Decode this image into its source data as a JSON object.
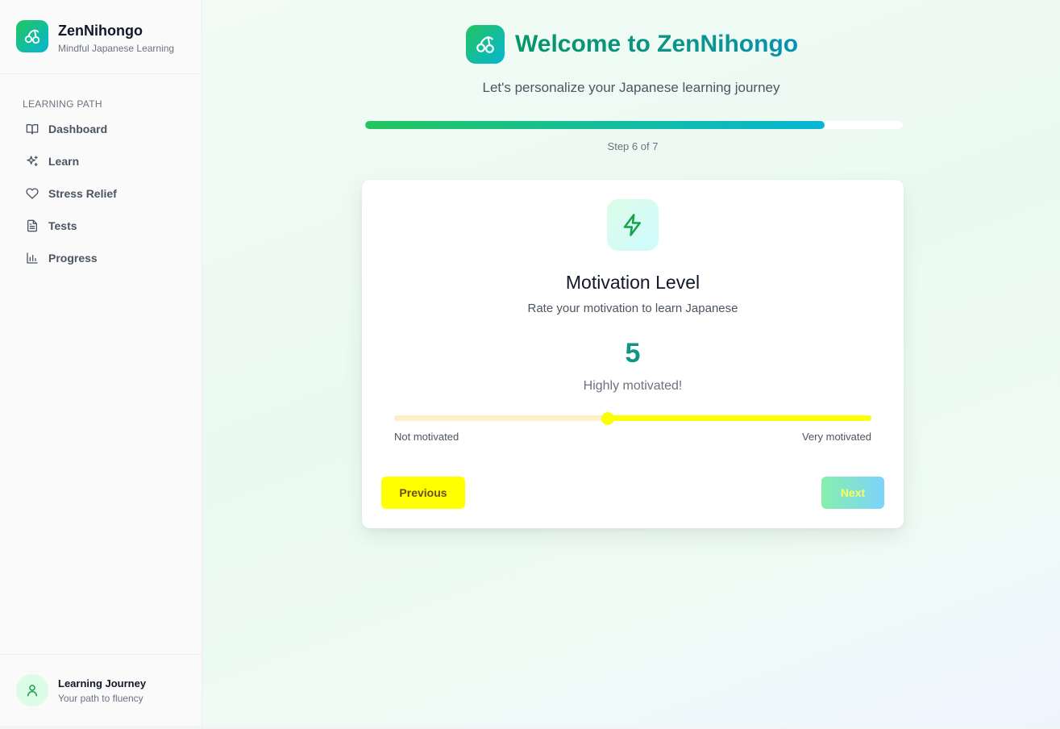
{
  "brand": {
    "title": "ZenNihongo",
    "subtitle": "Mindful Japanese Learning"
  },
  "sidebar": {
    "section_label": "LEARNING PATH",
    "items": [
      {
        "label": "Dashboard",
        "icon": "book-open-icon"
      },
      {
        "label": "Learn",
        "icon": "sparkles-icon"
      },
      {
        "label": "Stress Relief",
        "icon": "heart-icon"
      },
      {
        "label": "Tests",
        "icon": "file-text-icon"
      },
      {
        "label": "Progress",
        "icon": "bar-chart-icon"
      }
    ]
  },
  "user": {
    "name": "Learning Journey",
    "subtitle": "Your path to fluency",
    "icon": "user-icon"
  },
  "header": {
    "title": "Welcome to ZenNihongo",
    "subtitle": "Let's personalize your Japanese learning journey"
  },
  "progress": {
    "fraction": 0.855,
    "step_text": "Step 6 of 7"
  },
  "card": {
    "icon": "zap-icon",
    "title": "Motivation Level",
    "subtitle": "Rate your motivation to learn Japanese",
    "value": "5",
    "value_description": "Highly motivated!",
    "slider": {
      "min_label": "Not motivated",
      "max_label": "Very motivated",
      "fraction": 0.447
    },
    "previous_label": "Previous",
    "next_label": "Next"
  },
  "colors": {
    "accent": "#0f9488",
    "gradient_start": "#22c55e",
    "gradient_end": "#06b6d4",
    "slider": "#fbff00"
  }
}
